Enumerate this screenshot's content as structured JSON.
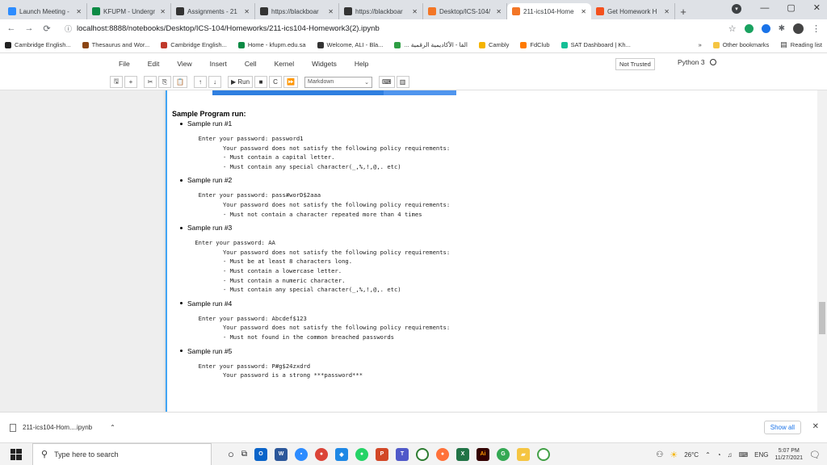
{
  "tabs": [
    {
      "title": "Launch Meeting - ",
      "color": "#2d8cff",
      "icon": "zoom-icon"
    },
    {
      "title": "KFUPM - Undergr",
      "color": "#0b8a44",
      "icon": "kfupm-icon"
    },
    {
      "title": "Assignments - 21",
      "color": "#333333",
      "icon": "blackboard-icon"
    },
    {
      "title": "https://blackboar",
      "color": "#333333",
      "icon": "blackboard-icon"
    },
    {
      "title": "https://blackboar",
      "color": "#333333",
      "icon": "blackboard-icon"
    },
    {
      "title": "Desktop/ICS-104/",
      "color": "#f37626",
      "icon": "jupyter-icon"
    },
    {
      "title": "211-ics104-Home",
      "color": "#f37626",
      "icon": "jupyter-icon",
      "active": true
    },
    {
      "title": "Get Homework H",
      "color": "#f4511e",
      "icon": "chegg-icon"
    }
  ],
  "address": {
    "url": "localhost:8888/notebooks/Desktop/ICS-104/Homeworks/211-ics104-Homework3(2).ipynb"
  },
  "bookmarks": [
    {
      "label": "Cambridge English...",
      "color": "#222"
    },
    {
      "label": "Thesaurus and Wor...",
      "color": "#8b4513"
    },
    {
      "label": "Cambridge English...",
      "color": "#c0392b"
    },
    {
      "label": "Home - kfupm.edu.sa",
      "color": "#0b8a44"
    },
    {
      "label": "Welcome, ALI - Bla...",
      "color": "#333"
    },
    {
      "label": "... الفا - الأكاديمية الرقمية",
      "color": "#2e9e44"
    },
    {
      "label": "Cambly",
      "color": "#f5b400"
    },
    {
      "label": "FdClub",
      "color": "#ff7a00"
    },
    {
      "label": "SAT Dashboard | Kh...",
      "color": "#14bf96"
    }
  ],
  "bookmarks_right": {
    "more": "»",
    "other": "Other bookmarks",
    "reading": "Reading list"
  },
  "menu": [
    "File",
    "Edit",
    "View",
    "Insert",
    "Cell",
    "Kernel",
    "Widgets",
    "Help"
  ],
  "trust_label": "Not Trusted",
  "kernel_name": "Python 3",
  "toolbar": {
    "run_label": "Run",
    "celltype": "Markdown"
  },
  "notebook": {
    "heading": "Sample Program run:",
    "runs": [
      {
        "label": "Sample run #1",
        "code": "  Enter your password: password1\n         Your password does not satisfy the following policy requirements:\n         - Must contain a capital letter.\n         - Must contain any special character(_,%,!,@,. etc)"
      },
      {
        "label": "Sample run #2",
        "code": "  Enter your password: pass#worD$2aaa\n         Your password does not satisfy the following policy requirements:\n         - Must not contain a character repeated more than 4 times"
      },
      {
        "label": "Sample run #3",
        "code": " Enter your password: AA\n         Your password does not satisfy the following policy requirements:\n         - Must be at least 8 characters long.\n         - Must contain a lowercase letter.\n         - Must contain a numeric character.\n         - Must contain any special character(_,%,!,@,. etc)"
      },
      {
        "label": "Sample run #4",
        "code": "  Enter your password: Abcdef$123\n         Your password does not satisfy the following policy requirements:\n         - Must not found in the common breached passwords"
      },
      {
        "label": "Sample run #5",
        "code": "  Enter your password: P#g$24zxdrd\n         Your password is a strong ***password***"
      }
    ]
  },
  "download": {
    "file": "211-ics104-Hom....ipynb",
    "show_all": "Show all"
  },
  "taskbar": {
    "search_placeholder": "Type here to search",
    "weather": "26°C",
    "lang": "ENG",
    "time": "5:07 PM",
    "date": "11/27/2021"
  }
}
